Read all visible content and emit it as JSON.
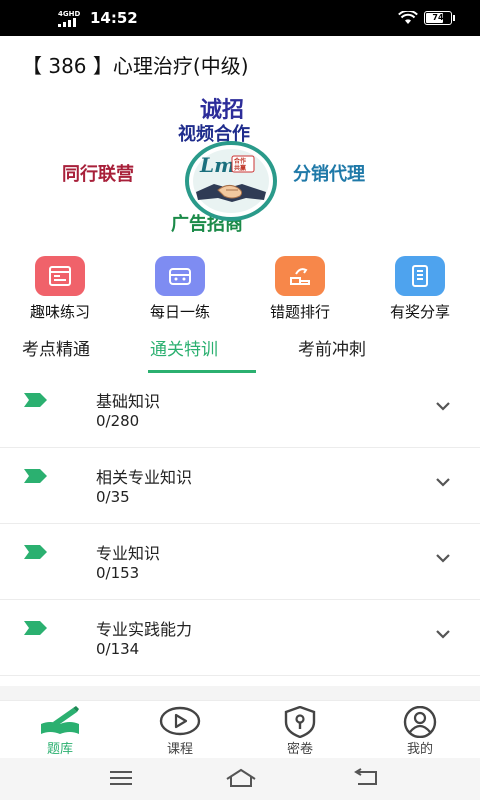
{
  "status": {
    "network": "4GHD",
    "time": "14:52",
    "battery": "74",
    "battery_level": 0.74
  },
  "header": {
    "title": "【 386 】心理治疗(中级)"
  },
  "banner": {
    "line1": "诚招",
    "line2": "视频合作",
    "left": "同行联营",
    "right": "分销代理",
    "bottom": "广告招商",
    "logo_text": "Lm",
    "logo_badge": "合作共赢"
  },
  "quick_actions": [
    {
      "label": "趣味练习",
      "icon": "practice-icon",
      "color": "#f0626a"
    },
    {
      "label": "每日一练",
      "icon": "daily-icon",
      "color": "#7e8cf2"
    },
    {
      "label": "错题排行",
      "icon": "wrong-rank-icon",
      "color": "#f7874a"
    },
    {
      "label": "有奖分享",
      "icon": "share-icon",
      "color": "#4ea3ee"
    }
  ],
  "tabs": [
    {
      "label": "考点精通",
      "active": false
    },
    {
      "label": "通关特训",
      "active": true
    },
    {
      "label": "考前冲刺",
      "active": false
    }
  ],
  "chapters": [
    {
      "name": "基础知识",
      "progress": "0/280"
    },
    {
      "name": "相关专业知识",
      "progress": "0/35"
    },
    {
      "name": "专业知识",
      "progress": "0/153"
    },
    {
      "name": "专业实践能力",
      "progress": "0/134"
    }
  ],
  "bottom_nav": [
    {
      "label": "题库",
      "icon": "question-bank-icon",
      "active": true
    },
    {
      "label": "课程",
      "icon": "play-icon",
      "active": false
    },
    {
      "label": "密卷",
      "icon": "lock-shield-icon",
      "active": false
    },
    {
      "label": "我的",
      "icon": "user-icon",
      "active": false
    }
  ],
  "colors": {
    "accent": "#2bb070",
    "text": "#222222"
  }
}
